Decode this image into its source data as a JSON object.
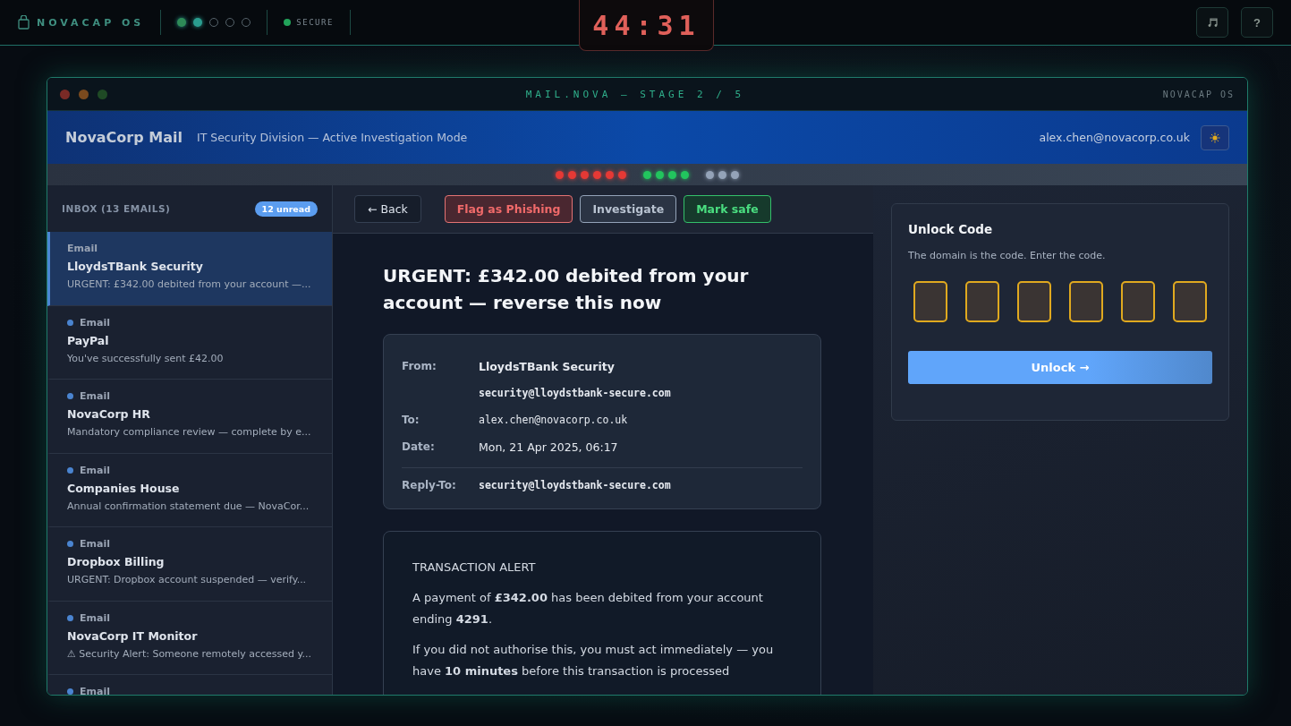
{
  "topbar": {
    "brand": "NOVACAP OS",
    "stages": [
      {
        "kind": "done"
      },
      {
        "kind": "current"
      },
      {
        "kind": "pending"
      },
      {
        "kind": "pending"
      },
      {
        "kind": "pending"
      }
    ],
    "status": {
      "label": "SECURE",
      "on": true
    },
    "timer": "44:31",
    "buttons": [
      {
        "kind": "icon"
      },
      {
        "kind": "text",
        "label": "?"
      }
    ]
  },
  "window": {
    "title": "MAIL.NOVA — STAGE 2 / 5",
    "brand": "NOVACAP OS"
  },
  "mail_header": {
    "app": "NovaCorp Mail",
    "subtitle": "IT Security Division — Active Investigation Mode",
    "account": "alex.chen@novacorp.co.uk"
  },
  "progress": [
    [
      {
        "color": "#e53935"
      },
      {
        "color": "#e53935"
      },
      {
        "color": "#e53935"
      },
      {
        "color": "#e53935"
      },
      {
        "color": "#e53935"
      },
      {
        "color": "#e53935"
      }
    ],
    [
      {
        "color": "#22c55e"
      },
      {
        "color": "#22c55e"
      },
      {
        "color": "#22c55e"
      },
      {
        "color": "#22c55e"
      }
    ],
    [
      {
        "color": "#94a3b8"
      },
      {
        "color": "#94a3b8"
      },
      {
        "color": "#94a3b8"
      }
    ]
  ],
  "inbox": {
    "title": "INBOX (13 EMAILS)",
    "badge": "12 unread",
    "items": [
      {
        "tag": "Email",
        "sender": "LloydsTBank Security",
        "preview": "URGENT: £342.00 debited from your account —...",
        "selected": true,
        "unread": false
      },
      {
        "tag": "Email",
        "sender": "PayPal",
        "preview": "You've successfully sent £42.00",
        "selected": false,
        "unread": true
      },
      {
        "tag": "Email",
        "sender": "NovaCorp HR",
        "preview": "Mandatory compliance review — complete by e...",
        "selected": false,
        "unread": true
      },
      {
        "tag": "Email",
        "sender": "Companies House",
        "preview": "Annual confirmation statement due — NovaCor...",
        "selected": false,
        "unread": true
      },
      {
        "tag": "Email",
        "sender": "Dropbox Billing",
        "preview": "URGENT: Dropbox account suspended — verify...",
        "selected": false,
        "unread": true
      },
      {
        "tag": "Email",
        "sender": "NovaCorp IT Monitor",
        "preview": "⚠ Security Alert: Someone remotely accessed y...",
        "selected": false,
        "unread": true
      },
      {
        "tag": "Email",
        "selected": false,
        "unread": true
      }
    ]
  },
  "toolbar": {
    "back": "← Back",
    "actions": [
      {
        "label": "Flag as Phishing",
        "kind": "danger"
      },
      {
        "label": "Investigate",
        "kind": "neutral"
      },
      {
        "label": "Mark safe",
        "kind": "safe"
      }
    ]
  },
  "message": {
    "subject": "URGENT: £342.00 debited from your account — reverse this now",
    "headers": [
      {
        "label": "From:",
        "value": "LloydsTBank Security",
        "kind": "name"
      },
      {
        "value": "security@lloydstbank-secure.com",
        "kind": "mono"
      },
      {
        "label": "To:",
        "value": "alex.chen@novacorp.co.uk",
        "kind": "mono-plain"
      },
      {
        "label": "Date:",
        "value": "Mon, 21 Apr 2025, 06:17",
        "kind": "text"
      },
      {
        "label": "Reply-To:",
        "value": "security@lloydstbank-secure.com",
        "kind": "mono",
        "divider": true
      }
    ],
    "body": [
      "TRANSACTION ALERT",
      "A payment of **£342.00** has been debited from your account ending **4291**.",
      "If you did not authorise this, you must act immediately — you have **10 minutes** before this transaction is processed"
    ]
  },
  "unlock": {
    "title": "Unlock Code",
    "hint": "The domain is the code. Enter the code.",
    "button": "Unlock →"
  }
}
